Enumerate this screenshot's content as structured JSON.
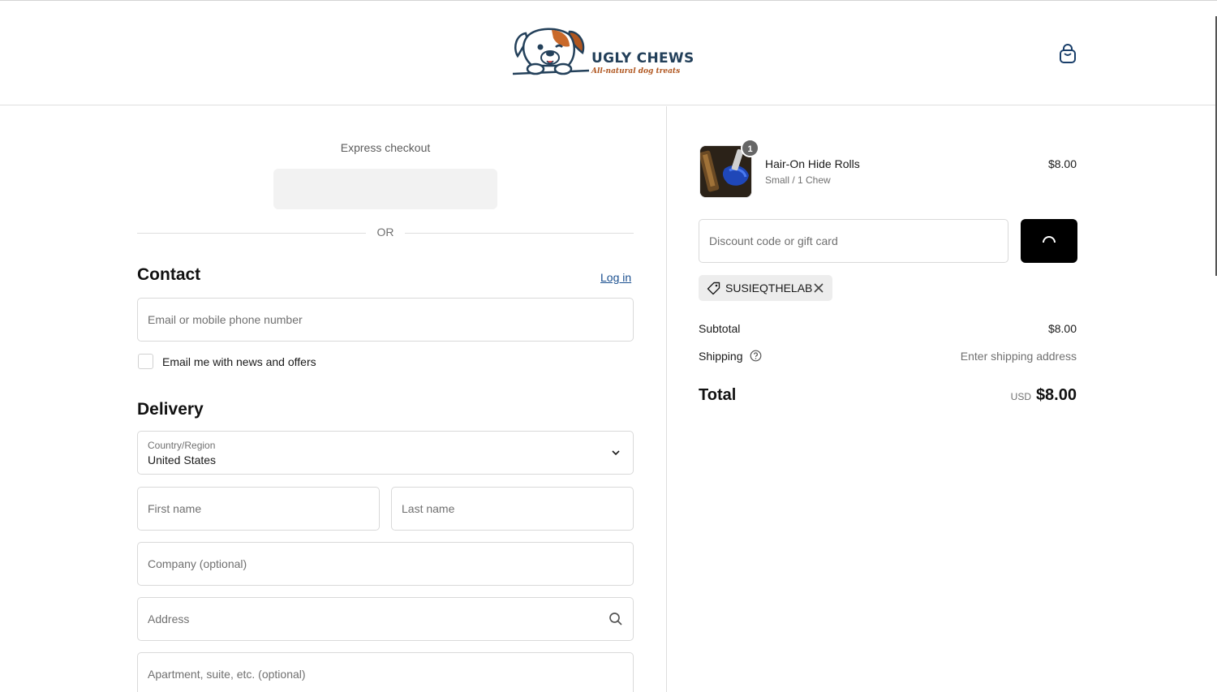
{
  "brand": {
    "name": "UGLY CHEWS",
    "tagline": "All-natural dog treats"
  },
  "express": {
    "label": "Express checkout",
    "or_text": "OR"
  },
  "contact": {
    "title": "Contact",
    "login_link": "Log in",
    "email_placeholder": "Email or mobile phone number",
    "newsletter_label": "Email me with news and offers",
    "newsletter_checked": false
  },
  "delivery": {
    "title": "Delivery",
    "country_label": "Country/Region",
    "country_value": "United States",
    "first_name_placeholder": "First name",
    "last_name_placeholder": "Last name",
    "company_placeholder": "Company (optional)",
    "address_placeholder": "Address",
    "apartment_placeholder": "Apartment, suite, etc. (optional)"
  },
  "order": {
    "item": {
      "name": "Hair-On Hide Rolls",
      "variant": "Small / 1 Chew",
      "price": "$8.00",
      "quantity": "1"
    },
    "discount_placeholder": "Discount code or gift card",
    "applied_code": "SUSIEQTHELAB",
    "subtotal_label": "Subtotal",
    "subtotal_value": "$8.00",
    "shipping_label": "Shipping",
    "shipping_value": "Enter shipping address",
    "total_label": "Total",
    "total_currency": "USD",
    "total_value": "$8.00"
  },
  "icons": {
    "cart": "shopping-bag-icon",
    "chevron": "chevron-down-icon",
    "search": "search-icon",
    "tag": "tag-icon",
    "remove": "close-icon",
    "help": "question-circle-icon",
    "spinner": "loading-spinner-icon"
  },
  "colors": {
    "accent_link": "#1a4f8f",
    "button_bg": "#000000",
    "brand_navy": "#23405a",
    "brand_orange": "#b0561f"
  }
}
